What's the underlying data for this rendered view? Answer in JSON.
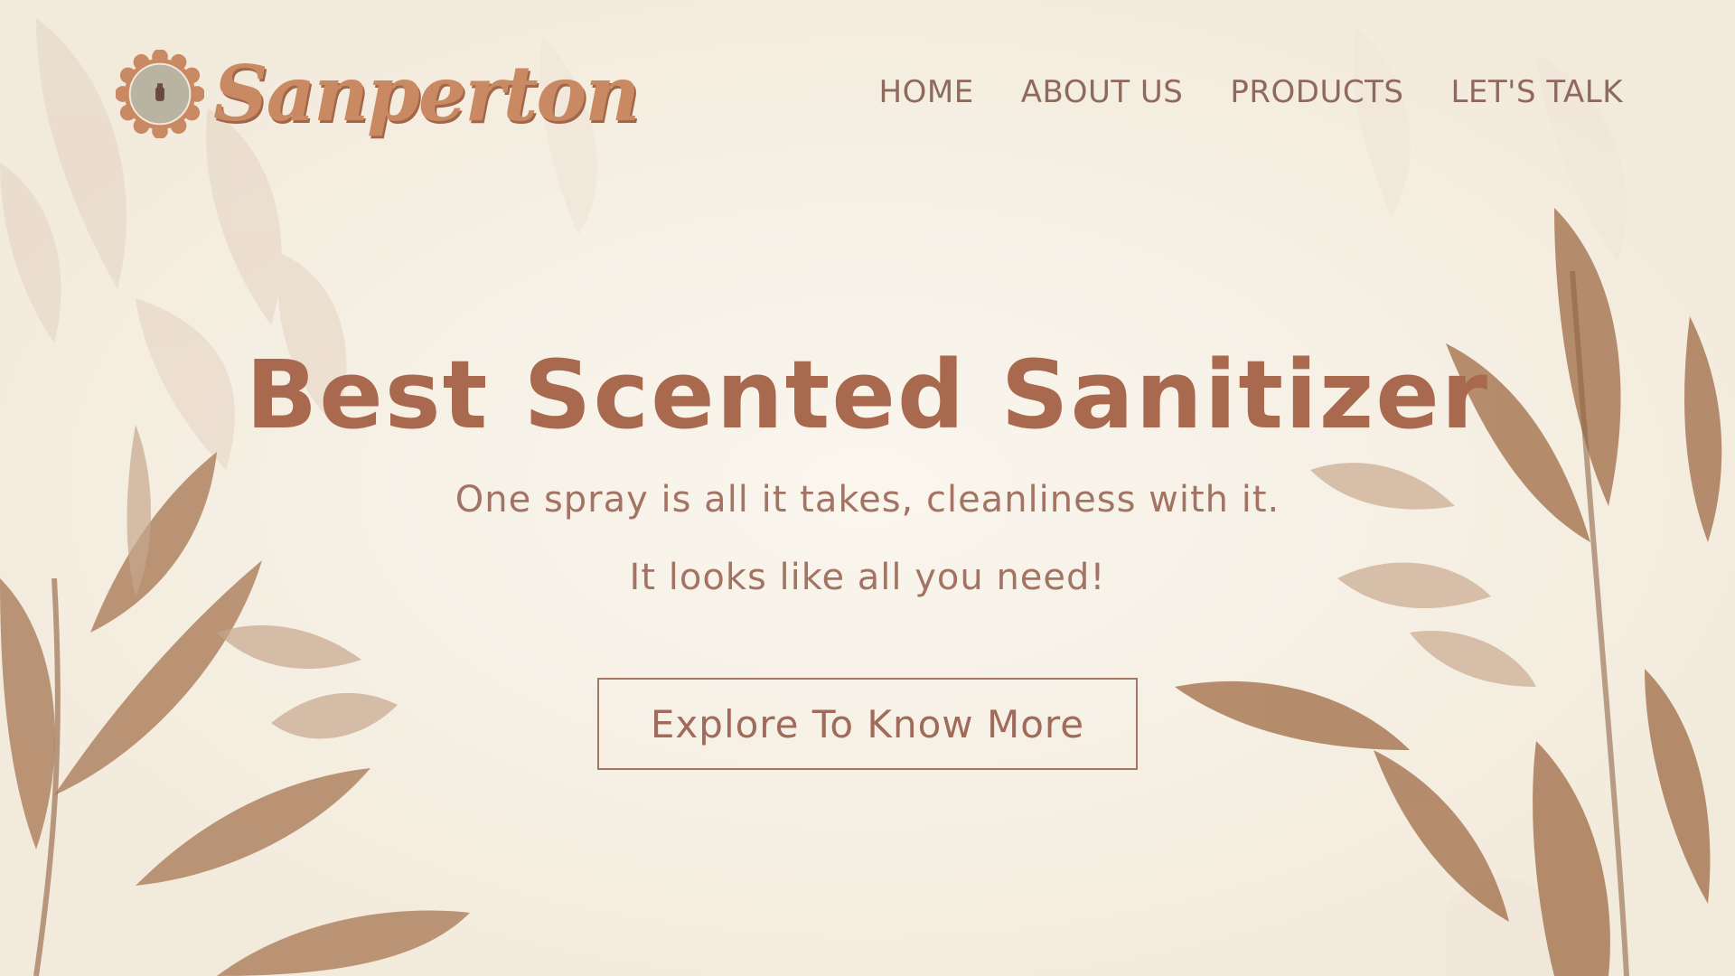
{
  "brand": {
    "name": "Sanperton",
    "logo_icon": "flower-badge-icon"
  },
  "nav": {
    "items": [
      {
        "label": "HOME"
      },
      {
        "label": "ABOUT US"
      },
      {
        "label": "PRODUCTS"
      },
      {
        "label": "LET'S TALK"
      }
    ]
  },
  "hero": {
    "title": "Best Scented Sanitizer",
    "line1": "One spray is all it takes, cleanliness with it.",
    "line2": "It looks like all you need!",
    "cta_label": "Explore To Know More"
  },
  "colors": {
    "background": "#f7f1e6",
    "title": "#a8694f",
    "text": "#a37463",
    "nav": "#8f6a5c",
    "logo_text": "#c98a63",
    "leaf": "#b08463"
  }
}
